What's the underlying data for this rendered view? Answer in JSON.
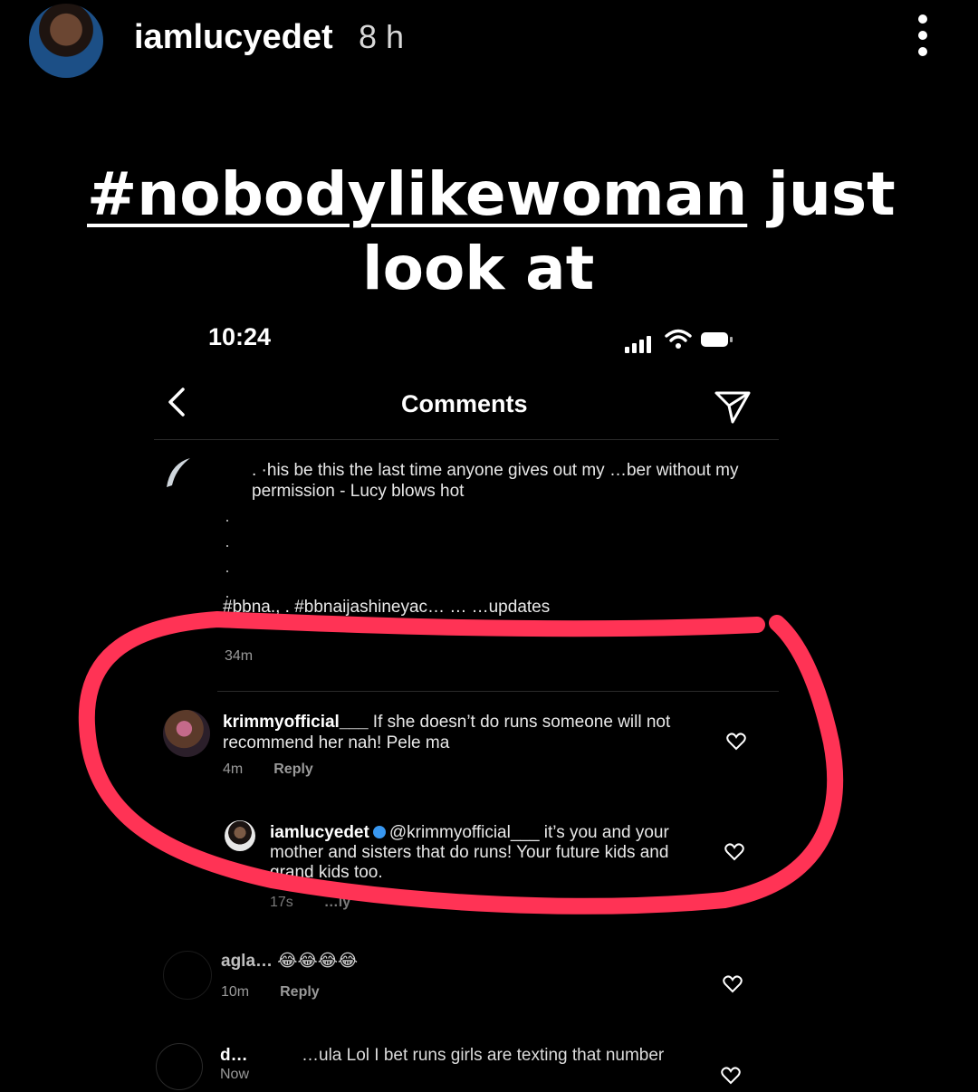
{
  "story": {
    "username": "iamlucyedet",
    "time": "8 h",
    "caption_hashtag": "#nobodylikewoman",
    "caption_rest_line1": " just",
    "caption_line2": "look at"
  },
  "phone": {
    "status_time": "10:24",
    "header_title": "Comments",
    "post_text": ". ·his be this the last time anyone gives out my …ber without my permission - Lucy blows hot",
    "post_tags": "#bbna., . #bbnaijashineyac… … …updates",
    "post_time": "34m",
    "comments": [
      {
        "username": "krimmyofficial___",
        "text": " If she doesn’t do runs someone will not recommend her nah! Pele ma",
        "time": "4m",
        "reply": "Reply"
      },
      {
        "username": "iamlucyedet",
        "text": "@krimmyofficial___ it’s you and your mother and sisters that do runs! Your future kids and grand kids too.",
        "time": "17s",
        "reply": "…ly"
      },
      {
        "username": "agla…",
        "text": " 😂😂😂😂",
        "time": "10m",
        "reply": "Reply"
      },
      {
        "username": "d…",
        "text": "…ula Lol I bet runs girls are texting that number",
        "time": "Now",
        "reply": ""
      }
    ]
  },
  "colors": {
    "highlight": "#ff3355",
    "verified": "#3897f0"
  }
}
